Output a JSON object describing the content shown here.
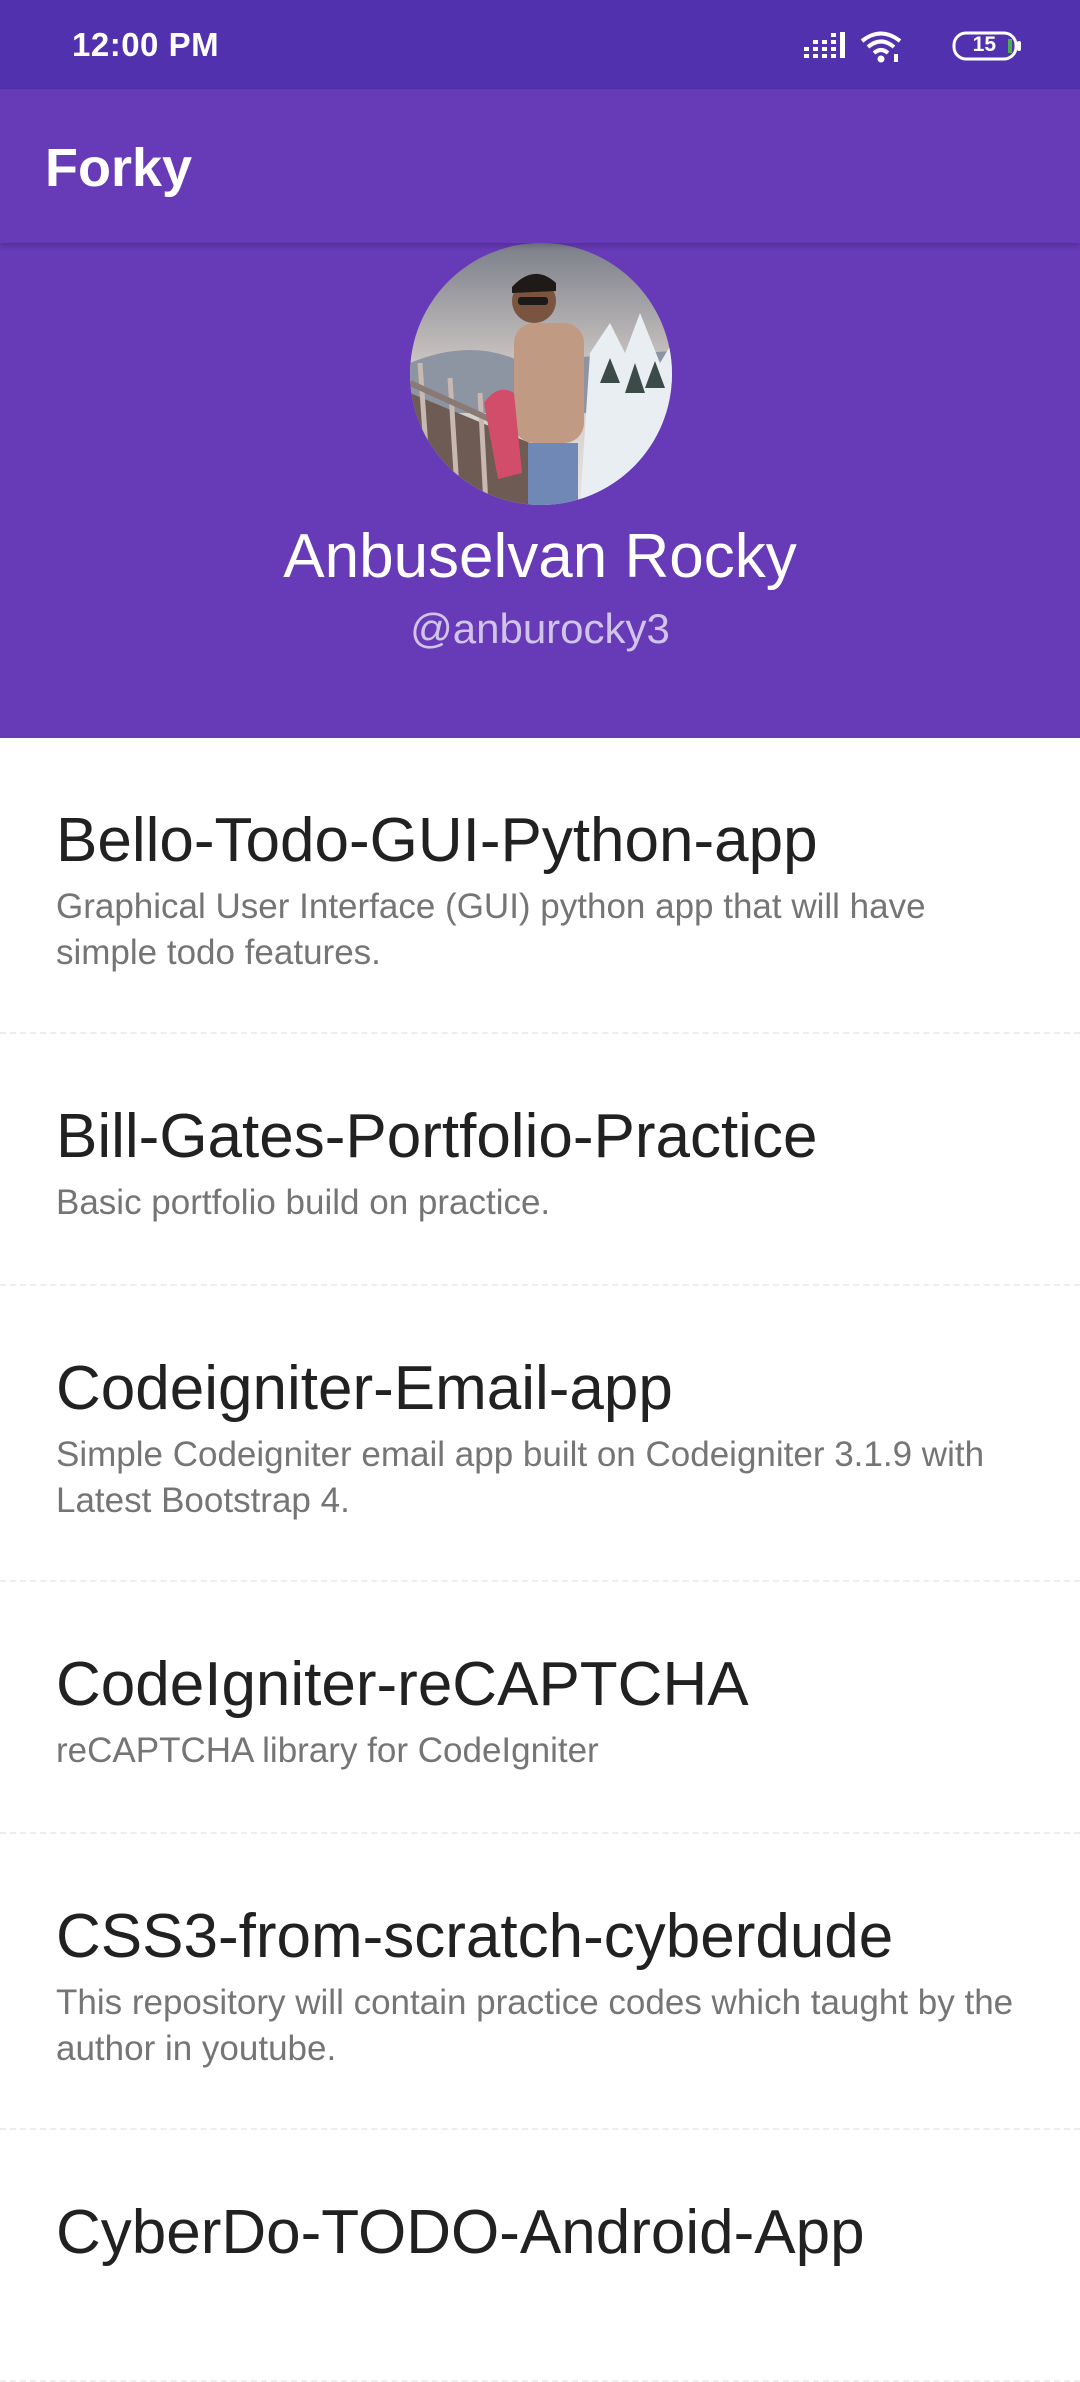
{
  "status_bar": {
    "time": "12:00 PM",
    "battery": "15",
    "icons": [
      "signal-icon",
      "wifi-icon",
      "battery-icon"
    ]
  },
  "app_bar": {
    "title": "Forky"
  },
  "profile": {
    "name": "Anbuselvan Rocky",
    "handle": "@anburocky3",
    "avatar": "profile-avatar"
  },
  "colors": {
    "primary": "#673ab7",
    "primary_dark": "#5131ad",
    "title_text": "#212121",
    "secondary_text": "#757575",
    "handle_text": "#d1c4e9"
  },
  "repos": [
    {
      "name": "Bello-Todo-GUI-Python-app",
      "description": "Graphical User Interface (GUI) python app that will have simple todo features."
    },
    {
      "name": "Bill-Gates-Portfolio-Practice",
      "description": "Basic portfolio build on practice."
    },
    {
      "name": "Codeigniter-Email-app",
      "description": "Simple Codeigniter email app built on Codeigniter 3.1.9 with Latest Bootstrap 4."
    },
    {
      "name": "CodeIgniter-reCAPTCHA",
      "description": "reCAPTCHA library for CodeIgniter"
    },
    {
      "name": "CSS3-from-scratch-cyberdude",
      "description": "This repository will contain practice codes which taught by the author in youtube."
    },
    {
      "name": "CyberDo-TODO-Android-App",
      "description": ""
    }
  ]
}
